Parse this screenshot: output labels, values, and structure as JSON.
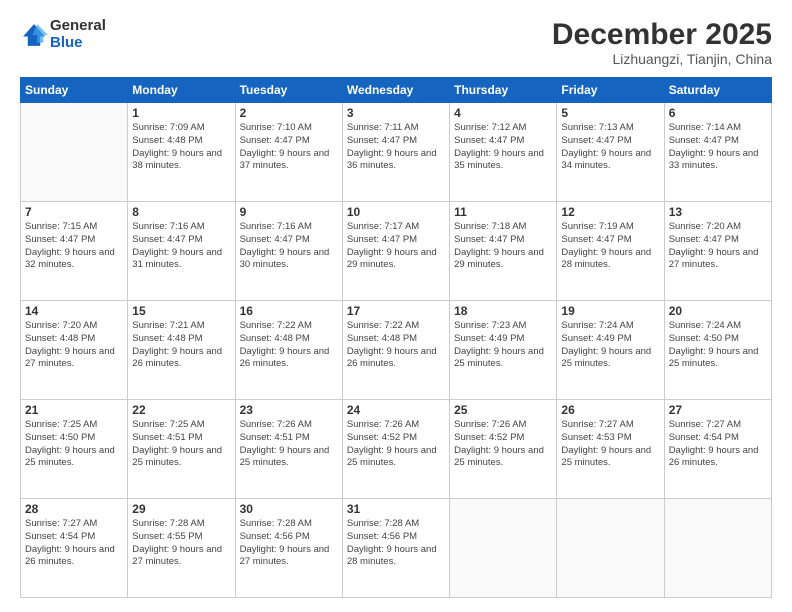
{
  "header": {
    "logo_general": "General",
    "logo_blue": "Blue",
    "month_title": "December 2025",
    "location": "Lizhuangzi, Tianjin, China"
  },
  "days_of_week": [
    "Sunday",
    "Monday",
    "Tuesday",
    "Wednesday",
    "Thursday",
    "Friday",
    "Saturday"
  ],
  "weeks": [
    [
      {
        "day": "",
        "sunrise": "",
        "sunset": "",
        "daylight": ""
      },
      {
        "day": "1",
        "sunrise": "Sunrise: 7:09 AM",
        "sunset": "Sunset: 4:48 PM",
        "daylight": "Daylight: 9 hours and 38 minutes."
      },
      {
        "day": "2",
        "sunrise": "Sunrise: 7:10 AM",
        "sunset": "Sunset: 4:47 PM",
        "daylight": "Daylight: 9 hours and 37 minutes."
      },
      {
        "day": "3",
        "sunrise": "Sunrise: 7:11 AM",
        "sunset": "Sunset: 4:47 PM",
        "daylight": "Daylight: 9 hours and 36 minutes."
      },
      {
        "day": "4",
        "sunrise": "Sunrise: 7:12 AM",
        "sunset": "Sunset: 4:47 PM",
        "daylight": "Daylight: 9 hours and 35 minutes."
      },
      {
        "day": "5",
        "sunrise": "Sunrise: 7:13 AM",
        "sunset": "Sunset: 4:47 PM",
        "daylight": "Daylight: 9 hours and 34 minutes."
      },
      {
        "day": "6",
        "sunrise": "Sunrise: 7:14 AM",
        "sunset": "Sunset: 4:47 PM",
        "daylight": "Daylight: 9 hours and 33 minutes."
      }
    ],
    [
      {
        "day": "7",
        "sunrise": "Sunrise: 7:15 AM",
        "sunset": "Sunset: 4:47 PM",
        "daylight": "Daylight: 9 hours and 32 minutes."
      },
      {
        "day": "8",
        "sunrise": "Sunrise: 7:16 AM",
        "sunset": "Sunset: 4:47 PM",
        "daylight": "Daylight: 9 hours and 31 minutes."
      },
      {
        "day": "9",
        "sunrise": "Sunrise: 7:16 AM",
        "sunset": "Sunset: 4:47 PM",
        "daylight": "Daylight: 9 hours and 30 minutes."
      },
      {
        "day": "10",
        "sunrise": "Sunrise: 7:17 AM",
        "sunset": "Sunset: 4:47 PM",
        "daylight": "Daylight: 9 hours and 29 minutes."
      },
      {
        "day": "11",
        "sunrise": "Sunrise: 7:18 AM",
        "sunset": "Sunset: 4:47 PM",
        "daylight": "Daylight: 9 hours and 29 minutes."
      },
      {
        "day": "12",
        "sunrise": "Sunrise: 7:19 AM",
        "sunset": "Sunset: 4:47 PM",
        "daylight": "Daylight: 9 hours and 28 minutes."
      },
      {
        "day": "13",
        "sunrise": "Sunrise: 7:20 AM",
        "sunset": "Sunset: 4:47 PM",
        "daylight": "Daylight: 9 hours and 27 minutes."
      }
    ],
    [
      {
        "day": "14",
        "sunrise": "Sunrise: 7:20 AM",
        "sunset": "Sunset: 4:48 PM",
        "daylight": "Daylight: 9 hours and 27 minutes."
      },
      {
        "day": "15",
        "sunrise": "Sunrise: 7:21 AM",
        "sunset": "Sunset: 4:48 PM",
        "daylight": "Daylight: 9 hours and 26 minutes."
      },
      {
        "day": "16",
        "sunrise": "Sunrise: 7:22 AM",
        "sunset": "Sunset: 4:48 PM",
        "daylight": "Daylight: 9 hours and 26 minutes."
      },
      {
        "day": "17",
        "sunrise": "Sunrise: 7:22 AM",
        "sunset": "Sunset: 4:48 PM",
        "daylight": "Daylight: 9 hours and 26 minutes."
      },
      {
        "day": "18",
        "sunrise": "Sunrise: 7:23 AM",
        "sunset": "Sunset: 4:49 PM",
        "daylight": "Daylight: 9 hours and 25 minutes."
      },
      {
        "day": "19",
        "sunrise": "Sunrise: 7:24 AM",
        "sunset": "Sunset: 4:49 PM",
        "daylight": "Daylight: 9 hours and 25 minutes."
      },
      {
        "day": "20",
        "sunrise": "Sunrise: 7:24 AM",
        "sunset": "Sunset: 4:50 PM",
        "daylight": "Daylight: 9 hours and 25 minutes."
      }
    ],
    [
      {
        "day": "21",
        "sunrise": "Sunrise: 7:25 AM",
        "sunset": "Sunset: 4:50 PM",
        "daylight": "Daylight: 9 hours and 25 minutes."
      },
      {
        "day": "22",
        "sunrise": "Sunrise: 7:25 AM",
        "sunset": "Sunset: 4:51 PM",
        "daylight": "Daylight: 9 hours and 25 minutes."
      },
      {
        "day": "23",
        "sunrise": "Sunrise: 7:26 AM",
        "sunset": "Sunset: 4:51 PM",
        "daylight": "Daylight: 9 hours and 25 minutes."
      },
      {
        "day": "24",
        "sunrise": "Sunrise: 7:26 AM",
        "sunset": "Sunset: 4:52 PM",
        "daylight": "Daylight: 9 hours and 25 minutes."
      },
      {
        "day": "25",
        "sunrise": "Sunrise: 7:26 AM",
        "sunset": "Sunset: 4:52 PM",
        "daylight": "Daylight: 9 hours and 25 minutes."
      },
      {
        "day": "26",
        "sunrise": "Sunrise: 7:27 AM",
        "sunset": "Sunset: 4:53 PM",
        "daylight": "Daylight: 9 hours and 25 minutes."
      },
      {
        "day": "27",
        "sunrise": "Sunrise: 7:27 AM",
        "sunset": "Sunset: 4:54 PM",
        "daylight": "Daylight: 9 hours and 26 minutes."
      }
    ],
    [
      {
        "day": "28",
        "sunrise": "Sunrise: 7:27 AM",
        "sunset": "Sunset: 4:54 PM",
        "daylight": "Daylight: 9 hours and 26 minutes."
      },
      {
        "day": "29",
        "sunrise": "Sunrise: 7:28 AM",
        "sunset": "Sunset: 4:55 PM",
        "daylight": "Daylight: 9 hours and 27 minutes."
      },
      {
        "day": "30",
        "sunrise": "Sunrise: 7:28 AM",
        "sunset": "Sunset: 4:56 PM",
        "daylight": "Daylight: 9 hours and 27 minutes."
      },
      {
        "day": "31",
        "sunrise": "Sunrise: 7:28 AM",
        "sunset": "Sunset: 4:56 PM",
        "daylight": "Daylight: 9 hours and 28 minutes."
      },
      {
        "day": "",
        "sunrise": "",
        "sunset": "",
        "daylight": ""
      },
      {
        "day": "",
        "sunrise": "",
        "sunset": "",
        "daylight": ""
      },
      {
        "day": "",
        "sunrise": "",
        "sunset": "",
        "daylight": ""
      }
    ]
  ]
}
